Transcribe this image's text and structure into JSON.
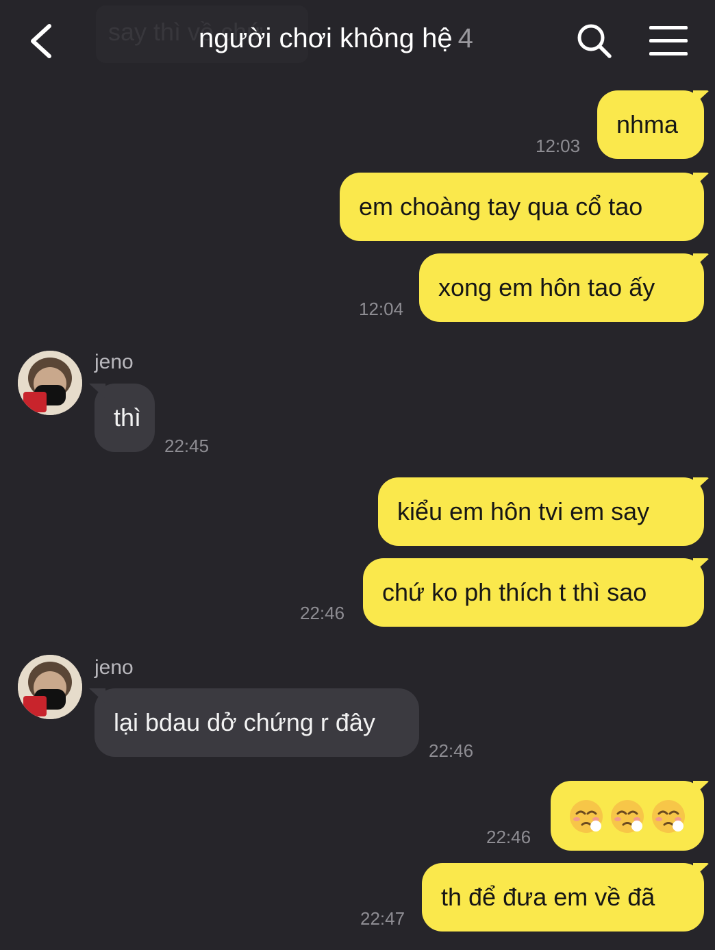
{
  "header": {
    "ghost_preview": "say thì về chứ",
    "title": "người chơi không hệ",
    "member_count": "4"
  },
  "messages": [
    {
      "id": "m1",
      "dir": "out",
      "text": "nhma",
      "time": "12:03"
    },
    {
      "id": "m2",
      "dir": "out",
      "text": "em choàng tay qua cổ tao",
      "time": ""
    },
    {
      "id": "m3",
      "dir": "out",
      "text": "xong em hôn tao ấy",
      "time": "12:04"
    },
    {
      "id": "m4",
      "dir": "in",
      "sender": "jeno",
      "text": "thì",
      "time": "22:45"
    },
    {
      "id": "m5",
      "dir": "out",
      "text": "kiểu em hôn tvi em say",
      "time": ""
    },
    {
      "id": "m6",
      "dir": "out",
      "text": "chứ ko ph thích t thì sao",
      "time": "22:46"
    },
    {
      "id": "m7",
      "dir": "in",
      "sender": "jeno",
      "text": "lại bdau dở chứng r đây",
      "time": "22:46"
    },
    {
      "id": "m8",
      "dir": "out",
      "emoji_count": 3,
      "emoji_name": "tired-face-emoji",
      "time": "22:46"
    },
    {
      "id": "m9",
      "dir": "out",
      "text": "th để đưa em về đã",
      "time": "22:47"
    }
  ],
  "colors": {
    "background": "#26252a",
    "outgoing_bubble": "#fae84c",
    "incoming_bubble": "#3b3a40"
  }
}
